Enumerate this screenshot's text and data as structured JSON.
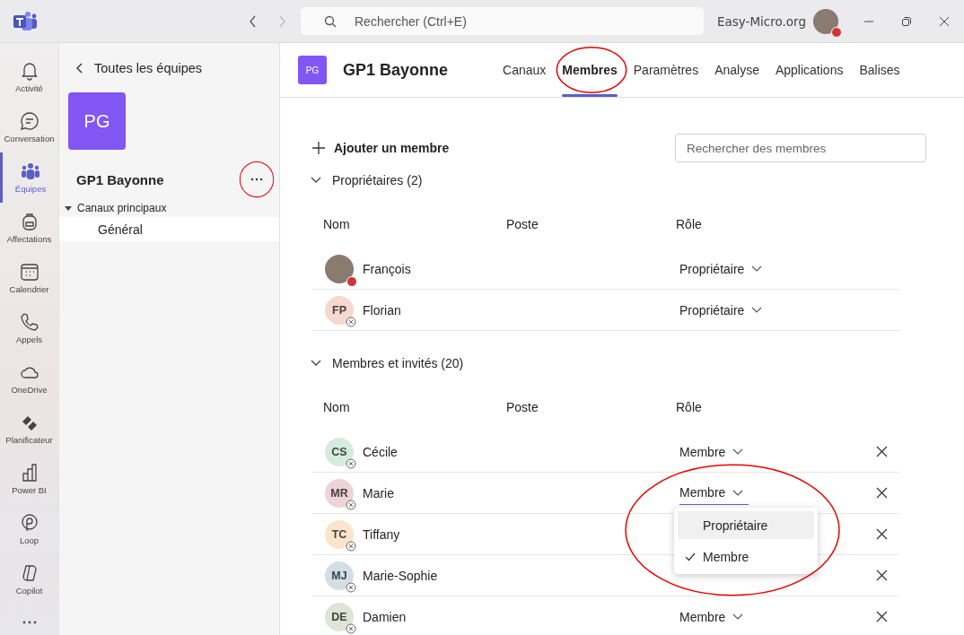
{
  "titlebar": {
    "search_placeholder": "Rechercher (Ctrl+E)",
    "org": "Easy-Micro.org",
    "busy": true
  },
  "rail": [
    {
      "label": "Activité",
      "kind": "bell",
      "selected": false
    },
    {
      "label": "Conversation",
      "kind": "chat",
      "selected": false
    },
    {
      "label": "Équipes",
      "kind": "teams",
      "selected": true
    },
    {
      "label": "Affectations",
      "kind": "backpack",
      "selected": false
    },
    {
      "label": "Calendrier",
      "kind": "calendar",
      "selected": false
    },
    {
      "label": "Appels",
      "kind": "phone",
      "selected": false
    },
    {
      "label": "OneDrive",
      "kind": "cloud",
      "selected": false
    },
    {
      "label": "Planificateur",
      "kind": "planner",
      "selected": false
    },
    {
      "label": "Power BI",
      "kind": "chart",
      "selected": false
    },
    {
      "label": "Loop",
      "kind": "loop",
      "selected": false
    },
    {
      "label": "Copilot",
      "kind": "copilot",
      "selected": false
    }
  ],
  "team_panel": {
    "back": "Toutes les équipes",
    "initials": "PG",
    "name": "GP1 Bayonne",
    "more_circled": true,
    "channel_group": {
      "label": "Canaux principaux",
      "expanded": true,
      "channels": [
        {
          "label": "Général",
          "selected": true
        }
      ]
    }
  },
  "header": {
    "initials": "PG",
    "title": "GP1 Bayonne",
    "tabs": [
      {
        "label": "Canaux",
        "selected": false,
        "circled": false
      },
      {
        "label": "Membres",
        "selected": true,
        "circled": true
      },
      {
        "label": "Paramètres",
        "selected": false,
        "circled": false
      },
      {
        "label": "Analyse",
        "selected": false,
        "circled": false
      },
      {
        "label": "Applications",
        "selected": false,
        "circled": false
      },
      {
        "label": "Balises",
        "selected": false,
        "circled": false
      }
    ]
  },
  "add_member": "Ajouter un membre",
  "search": {
    "placeholder": "Rechercher des membres"
  },
  "sections": [
    {
      "title": "Propriétaires (2)",
      "expanded": true,
      "columns": [
        "Nom",
        "Poste",
        "Rôle"
      ],
      "rows": [
        {
          "name": "François",
          "kind": "photo",
          "busy": true,
          "role": "Propriétaire",
          "removable": false
        },
        {
          "name": "Florian",
          "kind": "initials",
          "initials": "FP",
          "color": "#f6d8ce",
          "busy": false,
          "role": "Propriétaire",
          "removable": false
        }
      ]
    },
    {
      "title": "Membres et invités (20)",
      "expanded": true,
      "columns": [
        "Nom",
        "Poste",
        "Rôle"
      ],
      "rows": [
        {
          "name": "Cécile",
          "kind": "initials",
          "initials": "CS",
          "color": "#d5ecdd",
          "busy": false,
          "role": "Membre",
          "removable": true
        },
        {
          "name": "Marie",
          "kind": "initials",
          "initials": "MR",
          "color": "#ecd4d8",
          "busy": false,
          "role": "Membre",
          "role_open": true,
          "removable": true,
          "menu": {
            "circled": true,
            "options": [
              {
                "label": "Propriétaire",
                "highlighted": true,
                "selected": false
              },
              {
                "label": "Membre",
                "highlighted": false,
                "selected": true
              }
            ]
          }
        },
        {
          "name": "Tiffany",
          "kind": "initials",
          "initials": "TC",
          "color": "#fbe5cc",
          "busy": false,
          "removable": true
        },
        {
          "name": "Marie-Sophie",
          "kind": "initials",
          "initials": "MJ",
          "color": "#d4dee6",
          "busy": false,
          "removable": true
        },
        {
          "name": "Damien",
          "kind": "initials",
          "initials": "DE",
          "color": "#dee4d6",
          "busy": false,
          "role": "Membre",
          "removable": true
        }
      ]
    }
  ]
}
